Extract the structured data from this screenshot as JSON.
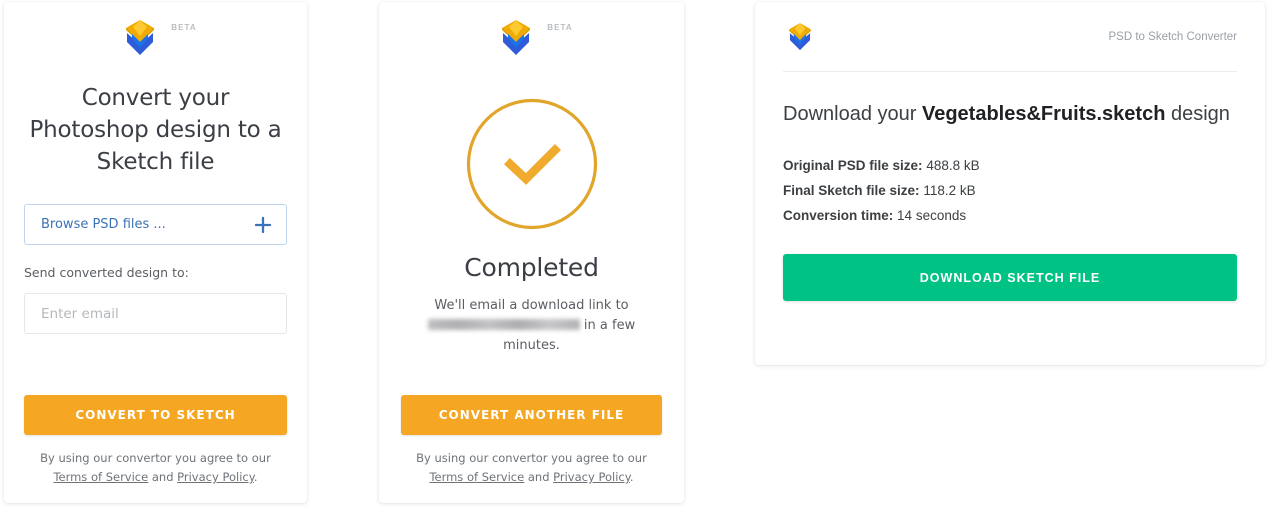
{
  "brand": {
    "logo_icon": "sketch-diamond-icon",
    "beta_badge": "BETA",
    "colors": {
      "amber": "#f5a623",
      "green": "#00c285",
      "blue_link": "#3b72b5",
      "check_ring": "#e2a52c",
      "logo_yellow": "#f7b500",
      "logo_blue": "#2d5bd7"
    }
  },
  "upload_card": {
    "headline": "Convert your Photoshop design to a Sketch file",
    "browse": {
      "label": "Browse PSD files ...",
      "add_icon": "plus-icon"
    },
    "email_label": "Send converted design to:",
    "email_value": "",
    "email_placeholder": "Enter email",
    "submit_label": "Convert to Sketch",
    "legal": {
      "prefix": "By using our convertor you agree to our",
      "terms": "Terms of Service",
      "conjunction": "and",
      "privacy": "Privacy Policy",
      "suffix": "."
    }
  },
  "completed_card": {
    "status_icon": "check-circle-icon",
    "title": "Completed",
    "message_prefix": "We'll email a download link to",
    "email_redacted": "",
    "message_suffix": "in a few minutes.",
    "action_label": "Convert another file",
    "legal": {
      "prefix": "By using our convertor you agree to our",
      "terms": "Terms of Service",
      "conjunction": "and",
      "privacy": "Privacy Policy",
      "suffix": "."
    }
  },
  "download_card": {
    "brand_label": "PSD to Sketch Converter",
    "title_prefix": "Download your",
    "file_name": "Vegetables&Fruits.sketch",
    "title_suffix": "design",
    "stats": [
      {
        "label": "Original PSD file size:",
        "value": "488.8 kB"
      },
      {
        "label": "Final Sketch file size:",
        "value": "118.2 kB"
      },
      {
        "label": "Conversion time:",
        "value": "14 seconds"
      }
    ],
    "download_label": "Download Sketch File"
  }
}
